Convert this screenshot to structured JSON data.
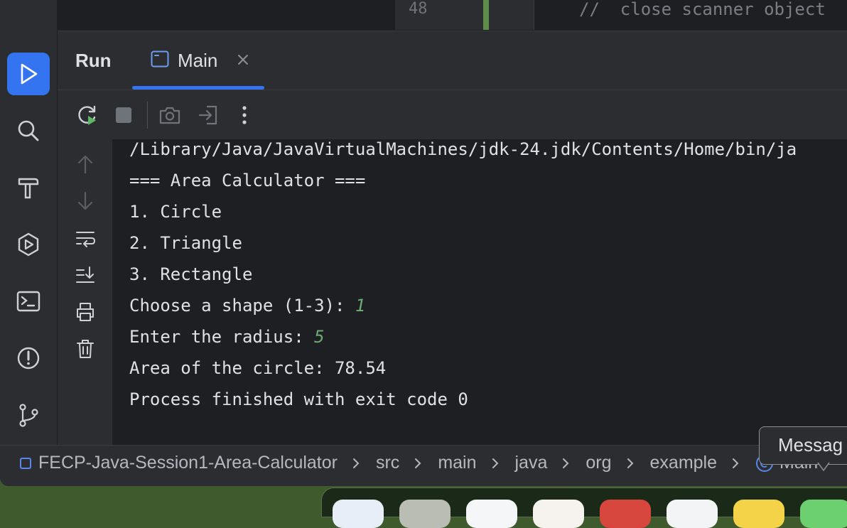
{
  "editor": {
    "line_number": "48",
    "code_line": "//  close scanner object"
  },
  "run_panel": {
    "title": "Run",
    "tab_label": "Main"
  },
  "console": {
    "lines": [
      {
        "text": "/Library/Java/JavaVirtualMachines/jdk-24.jdk/Contents/Home/bin/ja",
        "input": ""
      },
      {
        "text": "=== Area Calculator ===",
        "input": ""
      },
      {
        "text": "1. Circle",
        "input": ""
      },
      {
        "text": "2. Triangle",
        "input": ""
      },
      {
        "text": "3. Rectangle",
        "input": ""
      },
      {
        "text": "Choose a shape (1-3): ",
        "input": "1"
      },
      {
        "text": "Enter the radius: ",
        "input": "5"
      },
      {
        "text": "Area of the circle: 78.54",
        "input": ""
      },
      {
        "text": "Process finished with exit code 0",
        "input": ""
      }
    ]
  },
  "breadcrumb": {
    "items": [
      "FECP-Java-Session1-Area-Calculator",
      "src",
      "main",
      "java",
      "org",
      "example"
    ],
    "last": "Main"
  },
  "tooltip": {
    "text": "Messag"
  },
  "tool_strip_icons": [
    "run-icon",
    "search-icon",
    "build-hammer-icon",
    "services-icon",
    "terminal-icon",
    "problems-icon",
    "git-branch-icon"
  ],
  "colors": {
    "accent": "#3574f0",
    "panel": "#2b2d30",
    "background": "#1e1f22",
    "text": "#dfe1e5",
    "user_input": "#6aab73"
  }
}
